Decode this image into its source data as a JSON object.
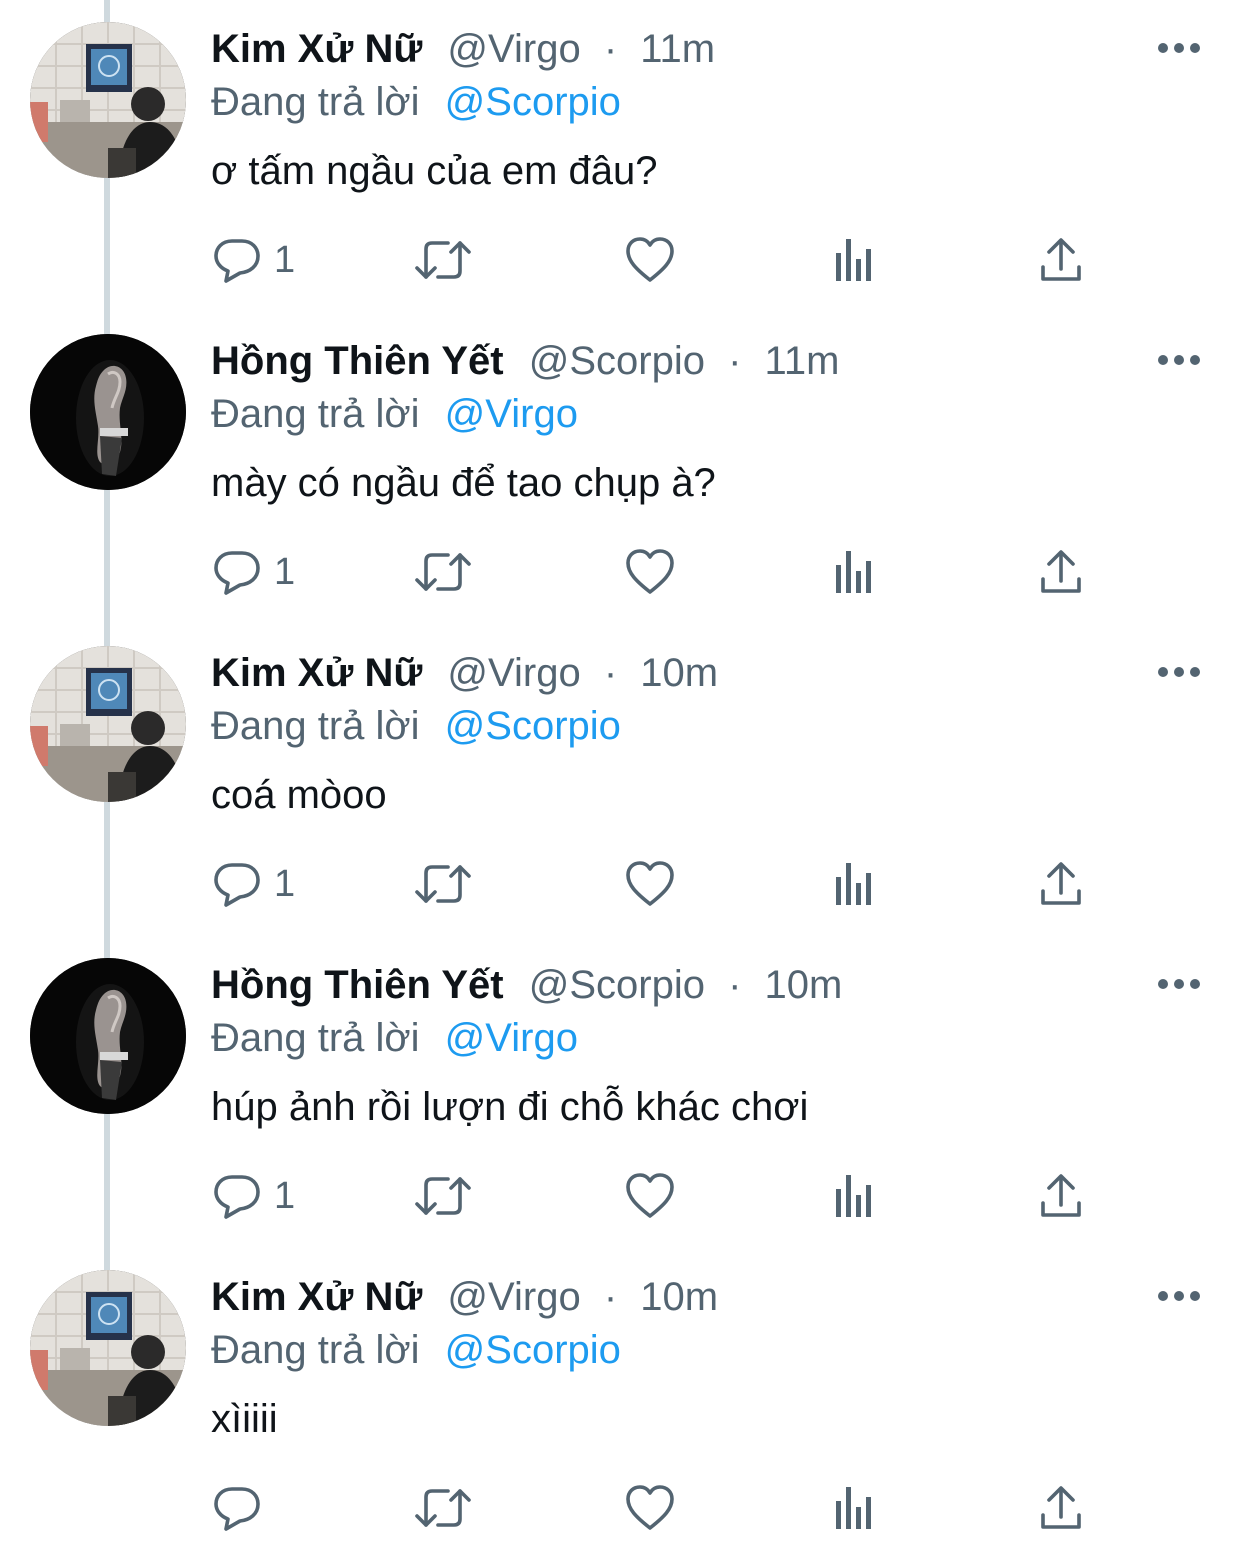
{
  "tweets": [
    {
      "display_name": "Kim Xử Nữ",
      "handle": "@Virgo",
      "separator": "·",
      "time": "11m",
      "replying_prefix": "Đang trả lời",
      "replying_to": "@Scorpio",
      "text": "ơ tấm ngầu của em đâu?",
      "reply_count": "1",
      "avatar": "light-photo"
    },
    {
      "display_name": "Hồng Thiên Yết",
      "handle": "@Scorpio",
      "separator": "·",
      "time": "11m",
      "replying_prefix": "Đang trả lời",
      "replying_to": "@Virgo",
      "text": "mày có ngầu để tao chụp à?",
      "reply_count": "1",
      "avatar": "dark-photo"
    },
    {
      "display_name": "Kim Xử Nữ",
      "handle": "@Virgo",
      "separator": "·",
      "time": "10m",
      "replying_prefix": "Đang trả lời",
      "replying_to": "@Scorpio",
      "text": "coá mòoo",
      "reply_count": "1",
      "avatar": "light-photo"
    },
    {
      "display_name": "Hồng Thiên Yết",
      "handle": "@Scorpio",
      "separator": "·",
      "time": "10m",
      "replying_prefix": "Đang trả lời",
      "replying_to": "@Virgo",
      "text": "húp ảnh rồi lượn đi chỗ khác chơi",
      "reply_count": "1",
      "avatar": "dark-photo"
    },
    {
      "display_name": "Kim Xử Nữ",
      "handle": "@Virgo",
      "separator": "·",
      "time": "10m",
      "replying_prefix": "Đang trả lời",
      "replying_to": "@Scorpio",
      "text": "xìiiii",
      "reply_count": "",
      "avatar": "light-photo"
    }
  ],
  "icons": {
    "reply": "reply-icon",
    "retweet": "retweet-icon",
    "like": "heart-icon",
    "views": "views-icon",
    "share": "share-icon",
    "more": "more-icon"
  },
  "colors": {
    "text": "#0f1419",
    "secondary": "#536471",
    "mention": "#1d9bf0",
    "thread_line": "#cfd9de"
  }
}
